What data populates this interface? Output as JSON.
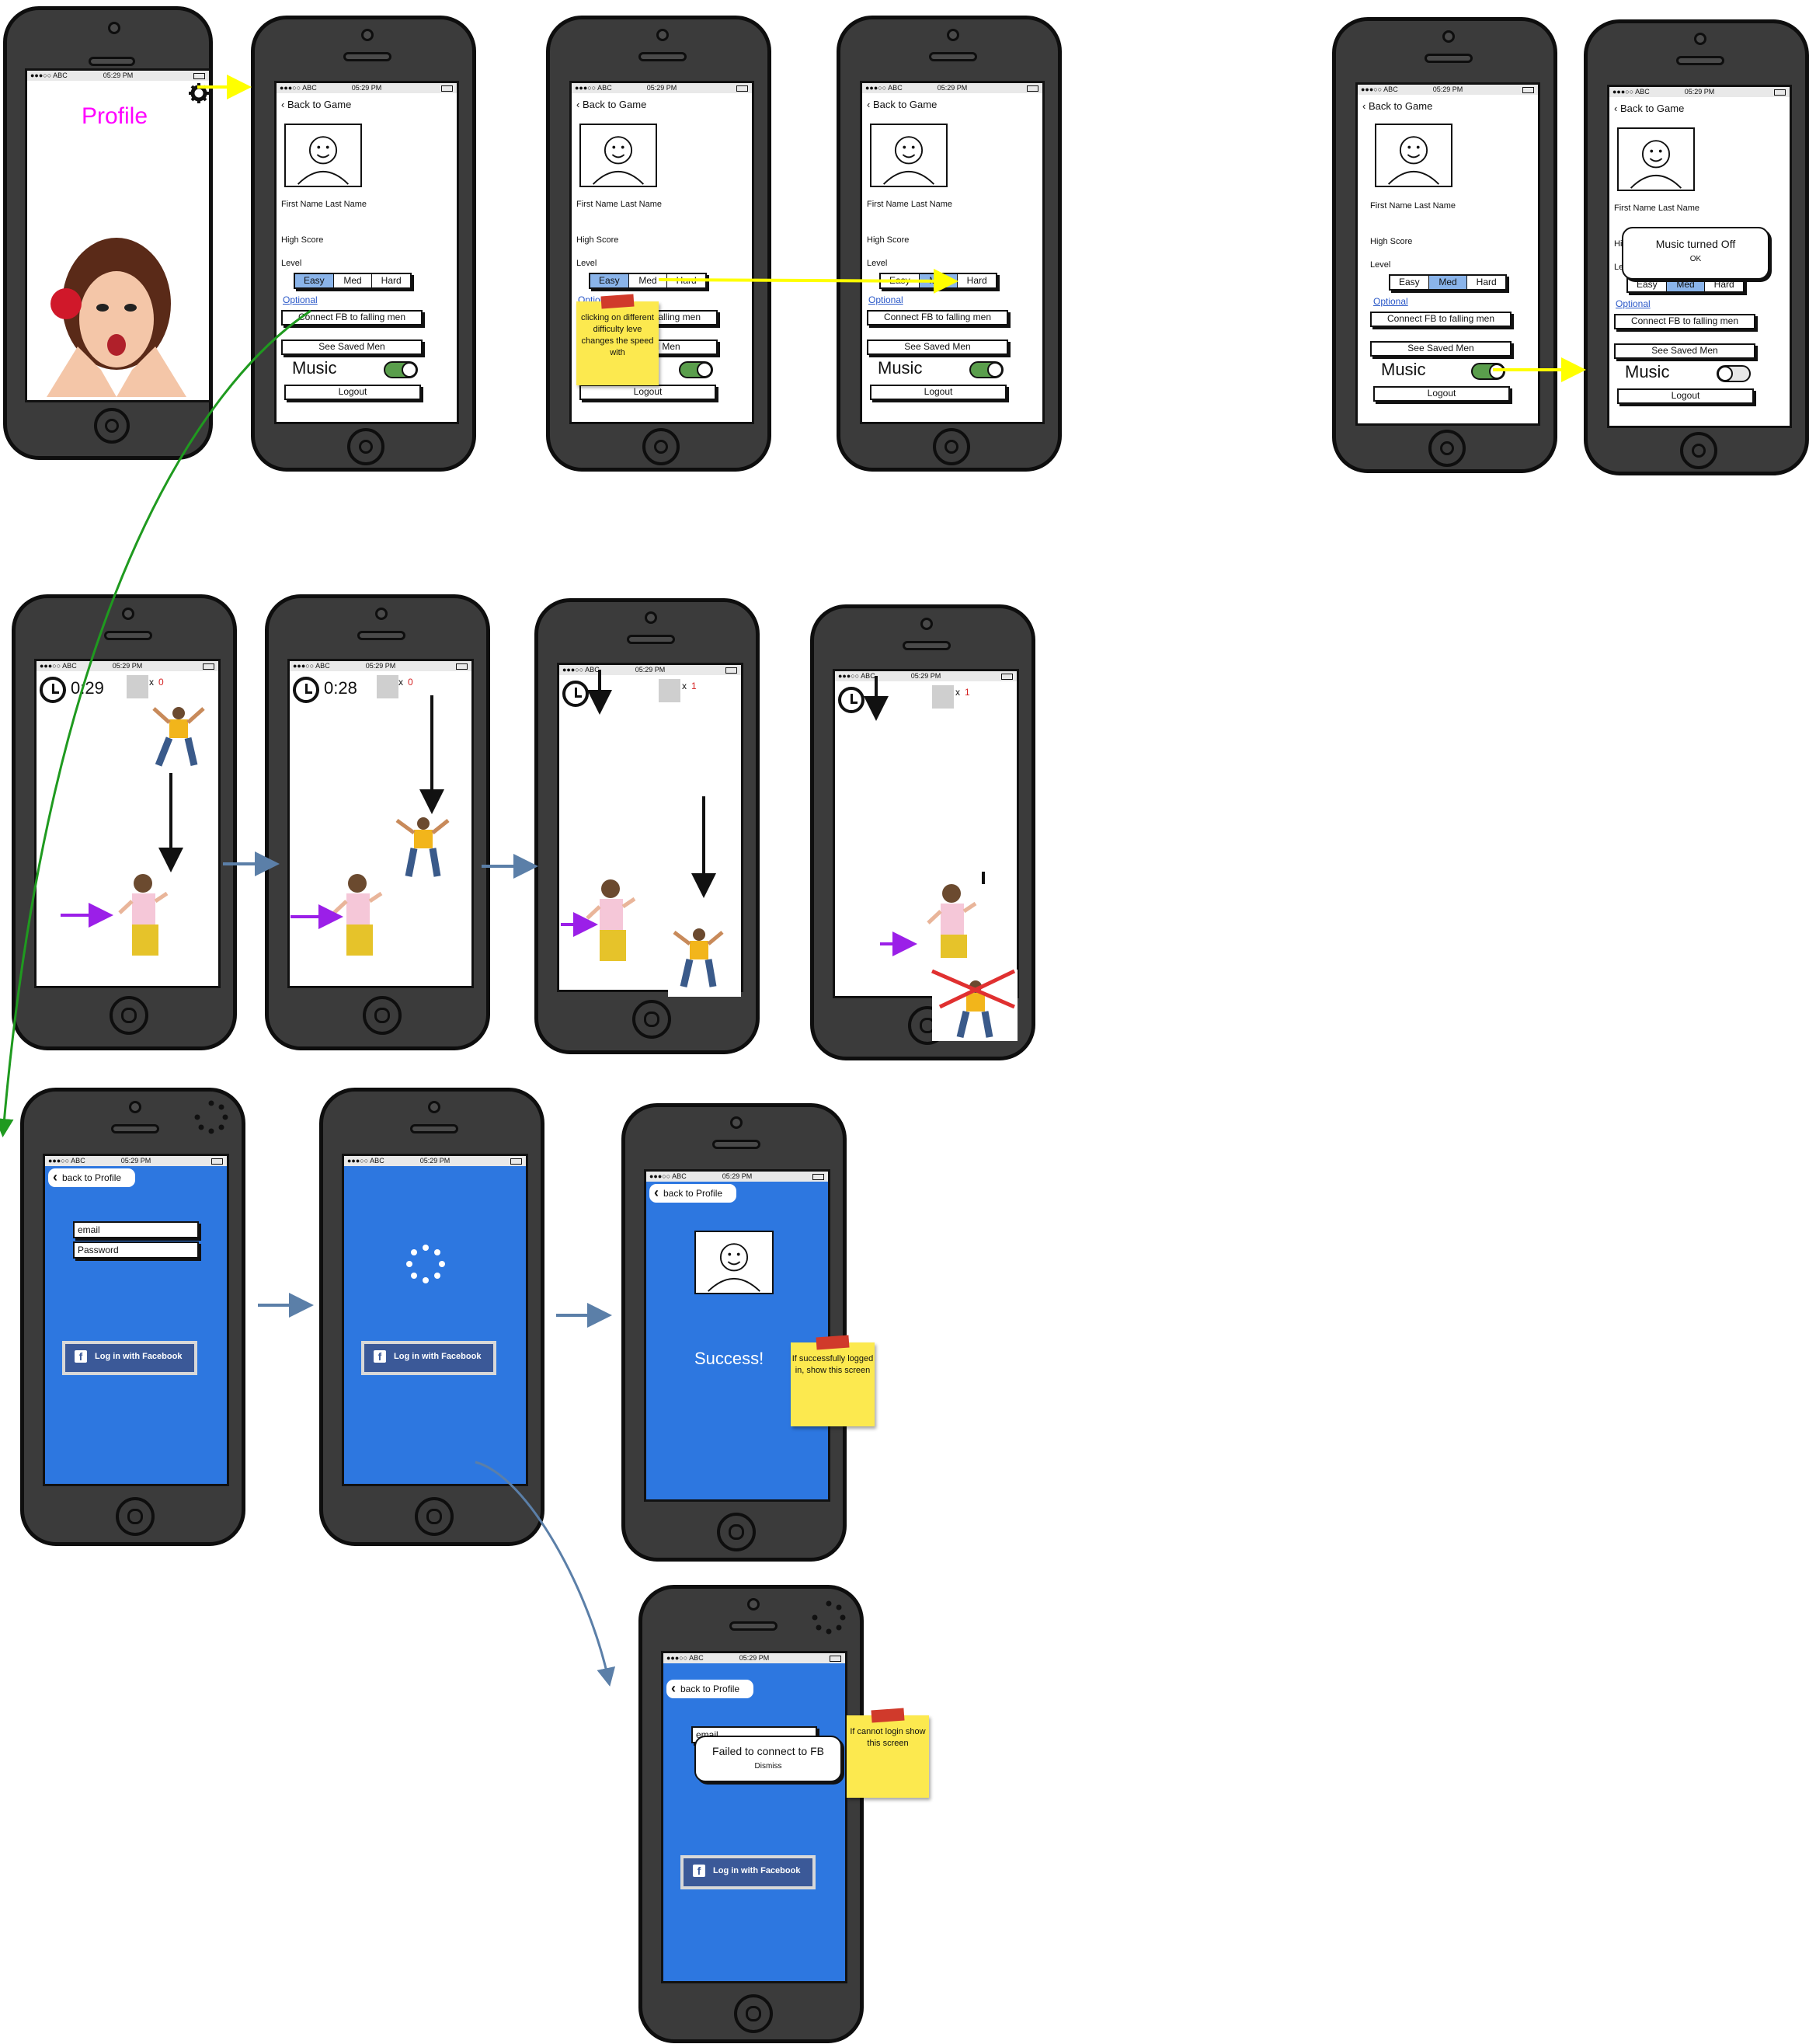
{
  "status_bar": {
    "carrier": "●●●○○ ABC",
    "time": "05:29 PM"
  },
  "profile_screen": {
    "title": "Profile"
  },
  "settings": {
    "back_label": "Back to Game",
    "name": "First Name Last Name",
    "high_score_label": "High Score",
    "level_label": "Level",
    "levels": [
      "Easy",
      "Med",
      "Hard"
    ],
    "optional_label": "Optional",
    "connect_fb_label": "Connect FB to falling men",
    "saved_men_label": "See Saved Men",
    "music_label": "Music",
    "logout_label": "Logout"
  },
  "sticky_notes": {
    "difficulty": "clicking on different difficulty leve changes the speed with",
    "success": "If successfully logged in, show this screen",
    "failed": "If cannot login show this screen"
  },
  "music_dialog": {
    "message": "Music turned Off",
    "ok": "OK"
  },
  "game": {
    "times": [
      "0:29",
      "0:28"
    ],
    "catch_counts": [
      "0",
      "0",
      "1",
      "1"
    ],
    "count_prefix": "x"
  },
  "facebook": {
    "back_label": "back to Profile",
    "email_placeholder": "email",
    "password_placeholder": "Password",
    "login_label": "Log in with Facebook",
    "success_text": "Success!",
    "failed_message": "Failed to connect to FB",
    "dismiss": "Dismiss"
  },
  "colors": {
    "fb_screen": "#2d77e0",
    "toggle_on": "#5a9e4c",
    "segment_on": "#8ab4ea",
    "sticky": "#fce94f",
    "arrow_yellow": "#ffff00",
    "arrow_green": "#1f9a1f",
    "arrow_blue": "#5b7fa8",
    "arrow_purple": "#9b1fe8",
    "profile_title": "#ff00ff"
  }
}
